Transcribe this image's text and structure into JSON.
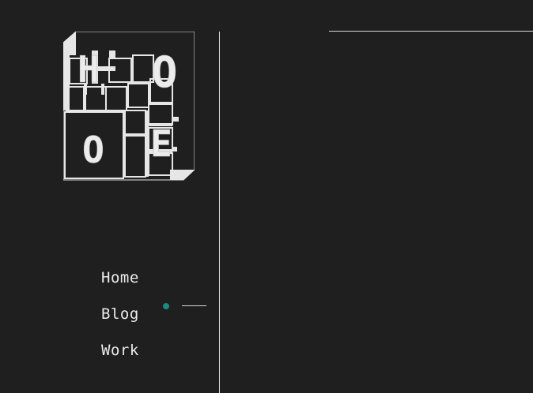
{
  "logo": {
    "letters": [
      "H",
      "O",
      "O",
      "E"
    ]
  },
  "nav": {
    "items": [
      {
        "label": "Home",
        "active": false
      },
      {
        "label": "Blog",
        "active": true
      },
      {
        "label": "Work",
        "active": false
      }
    ]
  },
  "colors": {
    "background": "#1f1f1f",
    "foreground": "#e8e8e8",
    "accent": "#1a8a80"
  }
}
